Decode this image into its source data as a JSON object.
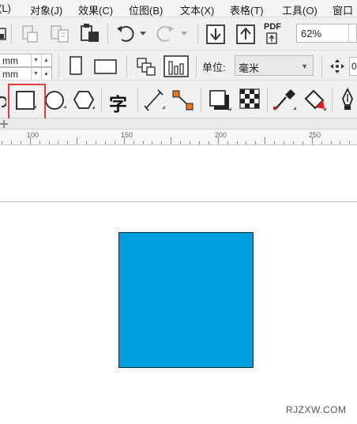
{
  "menubar": {
    "items": [
      {
        "label": "(L)"
      },
      {
        "label": "对象(J)"
      },
      {
        "label": "效果(C)"
      },
      {
        "label": "位图(B)"
      },
      {
        "label": "文本(X)"
      },
      {
        "label": "表格(T)"
      },
      {
        "label": "工具(O)"
      },
      {
        "label": "窗口"
      }
    ]
  },
  "toolbar_standard": {
    "pdf_label": "PDF",
    "zoom_value": "62%"
  },
  "property_bar": {
    "width_unit": "mm",
    "height_unit": "mm",
    "unit_label": "单位:",
    "unit_value": "毫米",
    "nudge_value": "0"
  },
  "toolbox": {
    "text_tool_glyph": "字"
  },
  "ruler": {
    "labels": [
      "100",
      "150",
      "200",
      "250"
    ]
  },
  "canvas": {
    "shape_fill": "#009fe3"
  },
  "watermark": "RJZXW.COM"
}
